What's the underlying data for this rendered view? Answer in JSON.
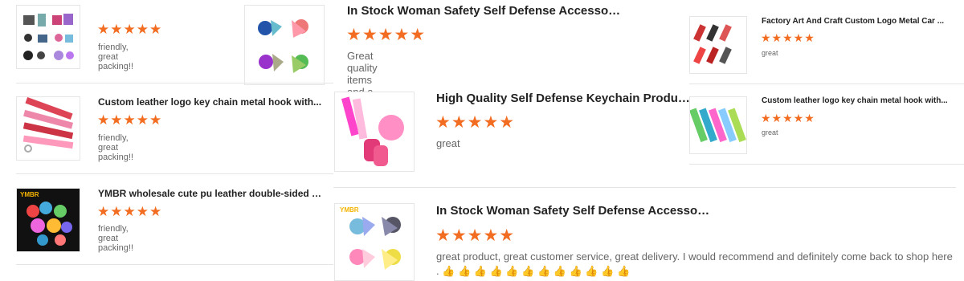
{
  "reviews": [
    {
      "id": "left-1",
      "title": "",
      "stars": "★★★★★",
      "comment": "friendly, great packing!!"
    },
    {
      "id": "left-2",
      "title": "Custom leather logo key chain metal hook with...",
      "stars": "★★★★★",
      "comment": "friendly, great packing!!"
    },
    {
      "id": "left-3",
      "title": "YMBR wholesale cute pu leather double-sided r...",
      "stars": "★★★★★",
      "comment": "friendly, great packing!!"
    },
    {
      "id": "mid-1",
      "title": "In Stock Woman Safety Self Defense Accessori...",
      "stars": "★★★★★",
      "comment": "Great quality items and a good price!"
    },
    {
      "id": "mid-2",
      "title": "High Quality Self Defense Keychain Products",
      "stars": "★★★★★",
      "comment": "great"
    },
    {
      "id": "mid-3",
      "title": "In Stock Woman Safety Self Defense Accessori...",
      "stars": "★★★★★",
      "comment": "great product, great customer service, great delivery. I would recommend and definitely come back to shop here . 👍 👍 👍 👍 👍 👍 👍 👍 👍 👍 👍 👍"
    },
    {
      "id": "right-1",
      "title": "Factory Art And Craft Custom Logo Metal Car ...",
      "stars": "★★★★★",
      "comment": "great"
    },
    {
      "id": "right-2",
      "title": "Custom leather logo key chain metal hook with...",
      "stars": "★★★★★",
      "comment": "great"
    }
  ],
  "brand_watermark": "YMBR",
  "colors": {
    "star": "#f26d21",
    "separator": "#e5e5e5",
    "text": "#222222",
    "muted": "#666666"
  }
}
